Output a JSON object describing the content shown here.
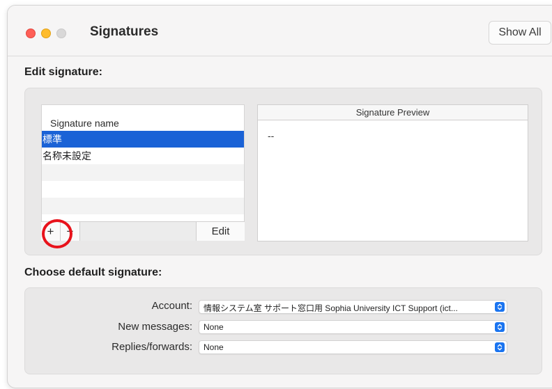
{
  "window": {
    "title": "Signatures",
    "show_all": "Show All"
  },
  "edit_section": {
    "label": "Edit signature:",
    "list_header": "Signature name",
    "items": [
      "標準",
      "名称未設定"
    ],
    "edit_button": "Edit",
    "add_symbol": "+",
    "remove_symbol": "−"
  },
  "preview": {
    "header": "Signature Preview",
    "content": "--"
  },
  "default_section": {
    "label": "Choose default signature:",
    "account_label": "Account:",
    "account_value": "情報システム室 サポート窓口用 Sophia University ICT Support (ict...",
    "new_messages_label": "New messages:",
    "new_messages_value": "None",
    "replies_label": "Replies/forwards:",
    "replies_value": "None"
  },
  "colors": {
    "selection": "#1a62d6",
    "accent": "#1a74f0",
    "callout": "#e8121b",
    "close": "#fe5f57",
    "minimize": "#febc2e"
  }
}
